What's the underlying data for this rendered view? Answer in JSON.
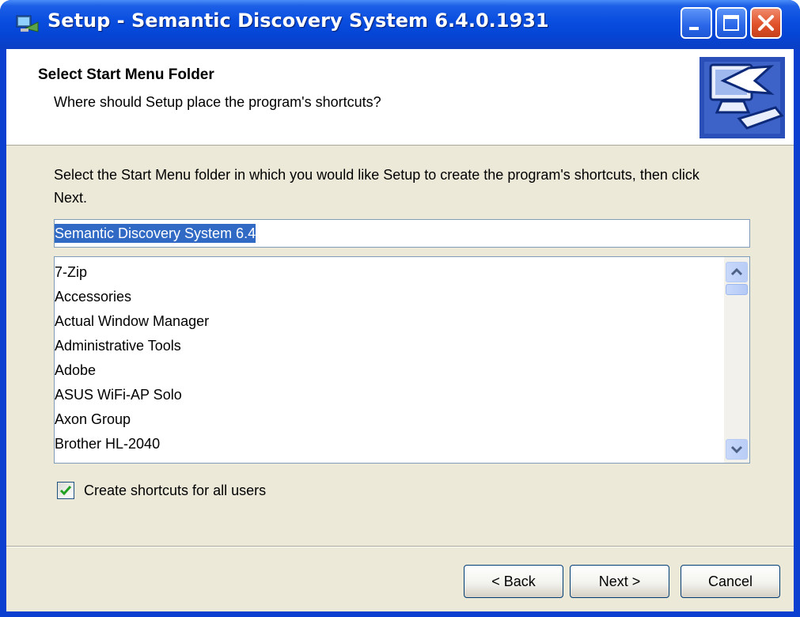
{
  "window": {
    "title": "Setup - Semantic Discovery System 6.4.0.1931",
    "app_icon": "setup-icon",
    "controls": [
      "minimize-icon",
      "maximize-icon",
      "close-icon"
    ]
  },
  "header": {
    "title": "Select Start Menu Folder",
    "subtitle": "Where should Setup place the program's shortcuts?",
    "image": "computer-shortcut-icon"
  },
  "main": {
    "instruction": "Select the Start Menu folder in which you would like Setup to create the program's shortcuts, then click Next.",
    "folder_input_value": "Semantic Discovery System 6.4",
    "folder_list": [
      "7-Zip",
      "Accessories",
      "Actual Window Manager",
      "Administrative Tools",
      "Adobe",
      "ASUS WiFi-AP Solo",
      "Axon Group",
      "Brother HL-2040"
    ],
    "checkbox": {
      "label": "Create shortcuts for all users",
      "checked": true
    }
  },
  "buttons": {
    "back": "< Back",
    "next": "Next >",
    "cancel": "Cancel"
  },
  "colors": {
    "titlebar": "#0a4fe0",
    "client_bg": "#ece9d8",
    "selection": "#316ac5"
  }
}
